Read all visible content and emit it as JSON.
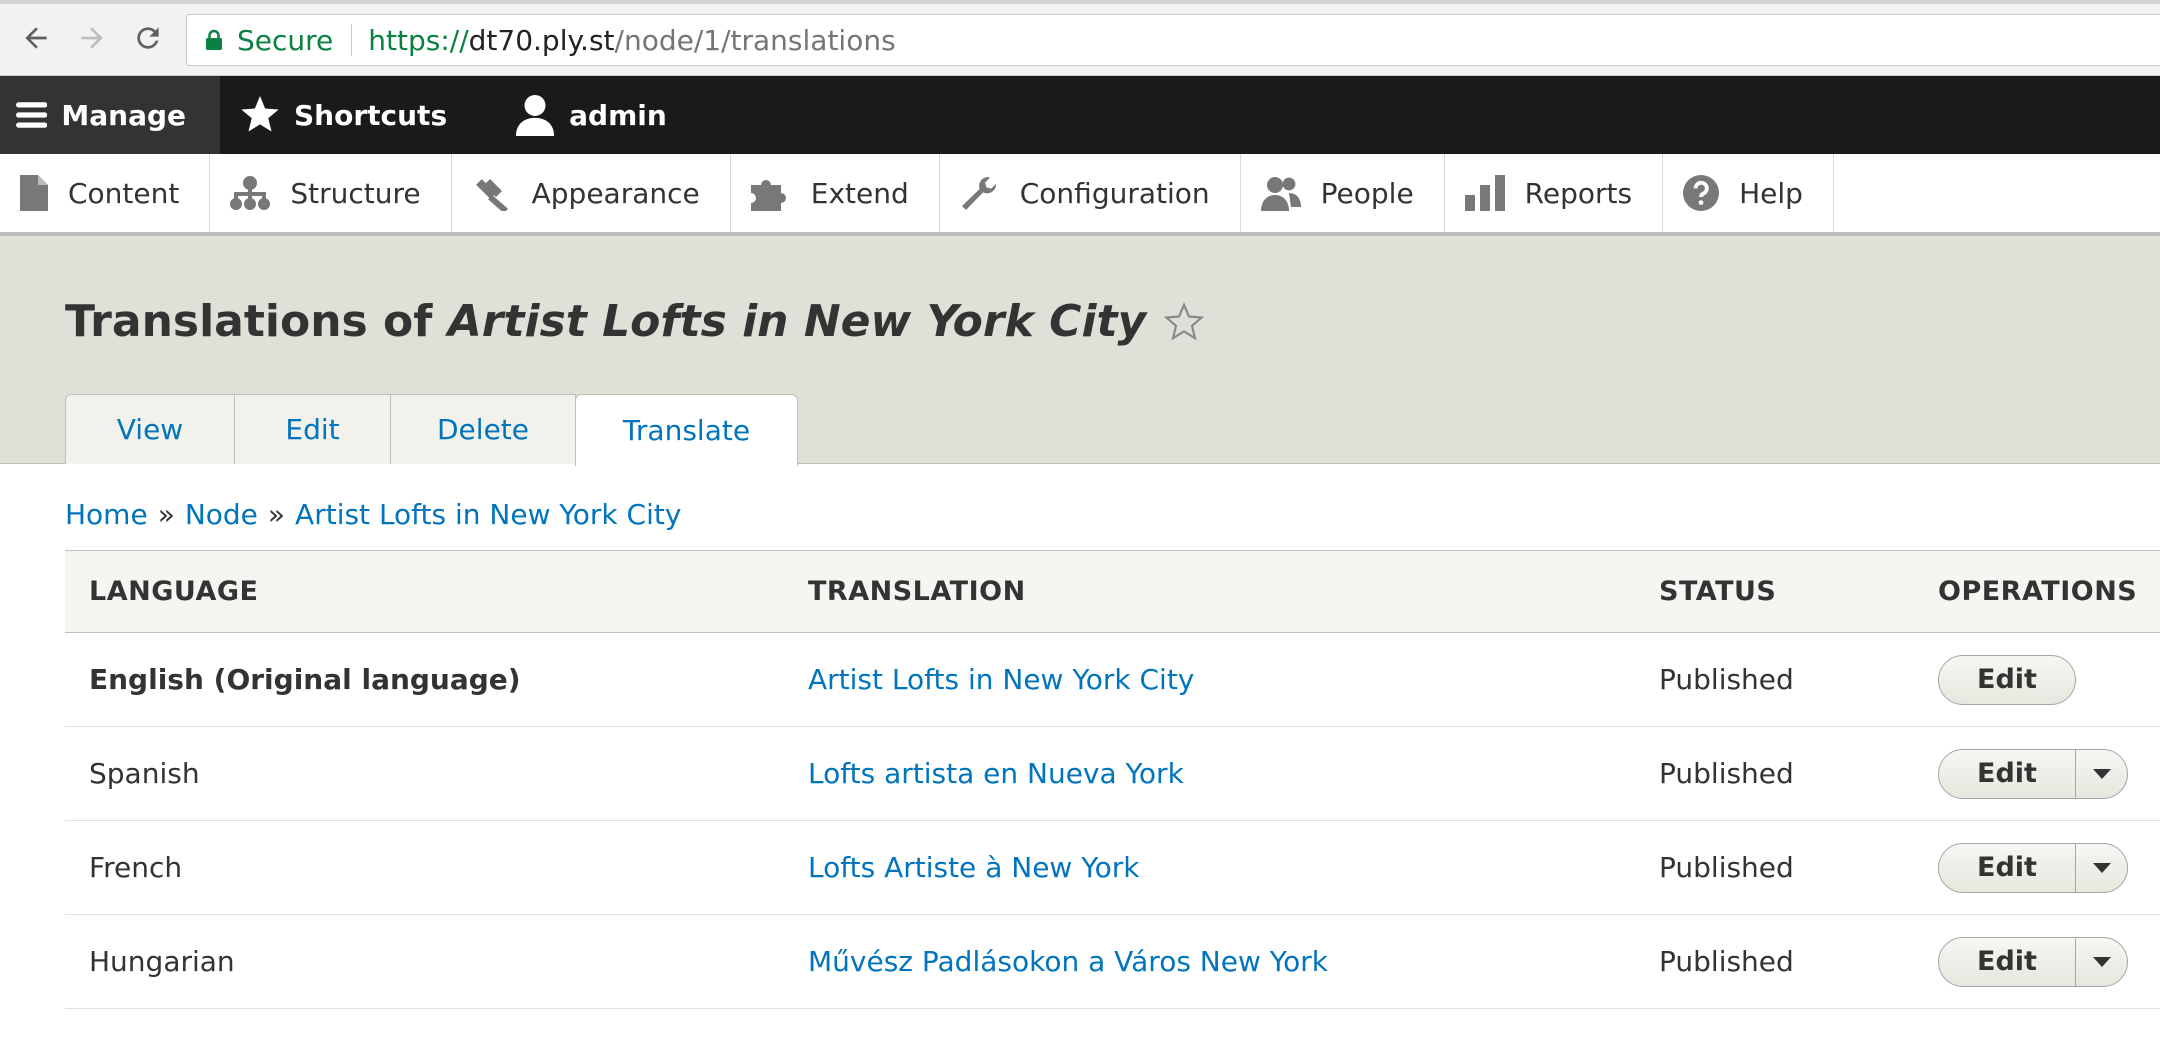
{
  "browser": {
    "secure_label": "Secure",
    "url_scheme": "https://",
    "url_host": "dt70.ply.st",
    "url_path": "/node/1/translations"
  },
  "toolbar": {
    "manage": "Manage",
    "shortcuts": "Shortcuts",
    "user": "admin"
  },
  "tray": {
    "items": [
      {
        "label": "Content",
        "icon": "file-icon"
      },
      {
        "label": "Structure",
        "icon": "structure-icon"
      },
      {
        "label": "Appearance",
        "icon": "brush-icon"
      },
      {
        "label": "Extend",
        "icon": "puzzle-icon"
      },
      {
        "label": "Configuration",
        "icon": "wrench-icon"
      },
      {
        "label": "People",
        "icon": "people-icon"
      },
      {
        "label": "Reports",
        "icon": "bar-chart-icon"
      },
      {
        "label": "Help",
        "icon": "help-icon"
      }
    ]
  },
  "page": {
    "title_prefix": "Translations of ",
    "title_node": "Artist Lofts in New York City"
  },
  "tabs": [
    "View",
    "Edit",
    "Delete",
    "Translate"
  ],
  "active_tab": "Translate",
  "breadcrumb": [
    "Home",
    "Node",
    "Artist Lofts in New York City"
  ],
  "breadcrumb_sep": "»",
  "table": {
    "headers": [
      "LANGUAGE",
      "TRANSLATION",
      "STATUS",
      "OPERATIONS"
    ],
    "rows": [
      {
        "language": "English (Original language)",
        "translation": "Artist Lofts in New York City",
        "status": "Published",
        "op": "Edit"
      },
      {
        "language": "Spanish",
        "translation": "Lofts artista en Nueva York",
        "status": "Published",
        "op": "Edit"
      },
      {
        "language": "French",
        "translation": "Lofts Artiste à New York",
        "status": "Published",
        "op": "Edit"
      },
      {
        "language": "Hungarian",
        "translation": "Művész Padlásokon a Város New York",
        "status": "Published",
        "op": "Edit"
      }
    ]
  },
  "colors": {
    "link": "#0074bd",
    "toolbar_bg": "#1a1a1a",
    "header_bg": "#e0e0d8",
    "secure_green": "#0b8043"
  }
}
